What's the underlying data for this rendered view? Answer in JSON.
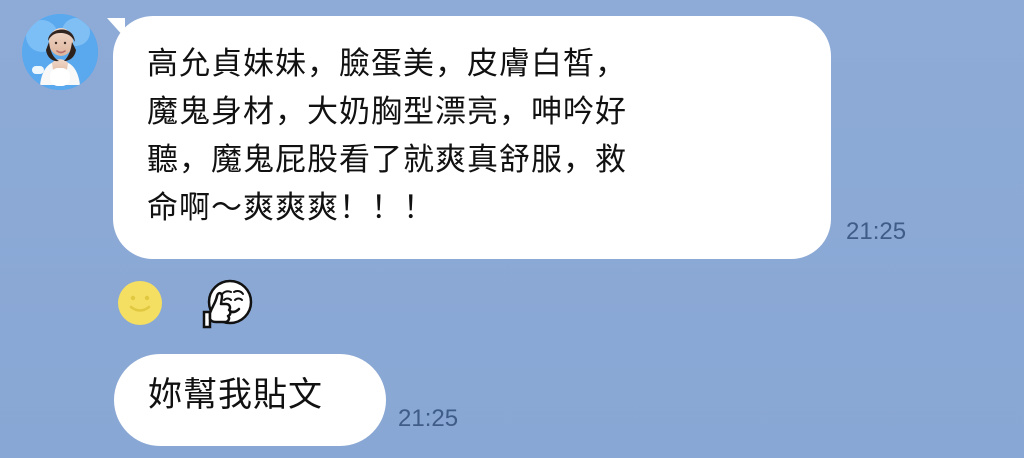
{
  "messages": [
    {
      "lines": [
        "高允貞妹妹，臉蛋美，皮膚白皙，",
        "魔鬼身材，大奶胸型漂亮，呻吟好",
        "聽，魔鬼屁股看了就爽真舒服，救",
        "命啊～爽爽爽！！！"
      ],
      "time": "21:25"
    },
    {
      "text": "妳幫我貼文",
      "time": "21:25"
    }
  ],
  "icons": {
    "avatar": "profile-avatar",
    "reaction_1": "smile-emoji",
    "reaction_2": "thumbs-up-emoji"
  },
  "colors": {
    "background": "#8caad6",
    "bubble": "#ffffff",
    "timestamp": "#3f5c88",
    "emoji_yellow": "#f4df62"
  }
}
